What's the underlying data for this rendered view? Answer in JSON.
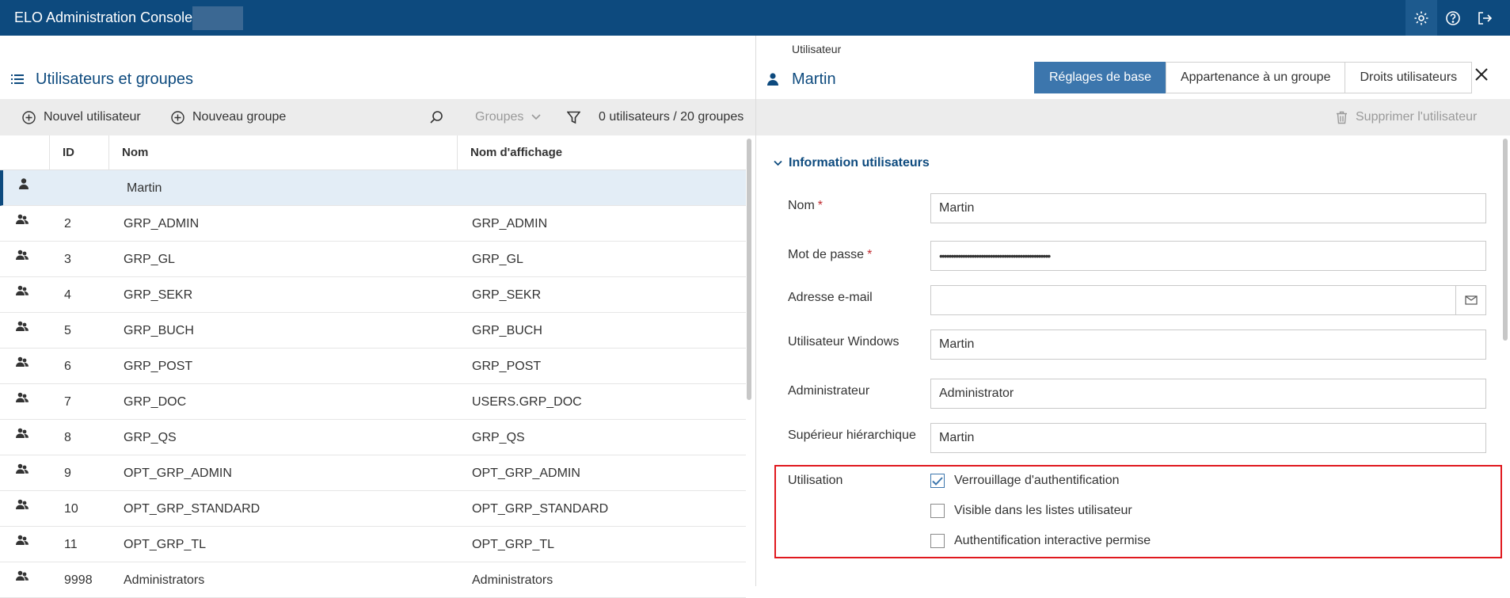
{
  "app": {
    "title": "ELO Administration Console"
  },
  "left": {
    "title": "Utilisateurs et groupes",
    "toolbar": {
      "new_user": "Nouvel utilisateur",
      "new_group": "Nouveau groupe",
      "filter_select": "Groupes",
      "count": "0 utilisateurs / 20 groupes"
    },
    "columns": {
      "id": "ID",
      "name": "Nom",
      "display": "Nom d'affichage"
    },
    "rows": [
      {
        "type": "user",
        "id": "",
        "name": "Martin",
        "display": ""
      },
      {
        "type": "group",
        "id": "2",
        "name": "GRP_ADMIN",
        "display": "GRP_ADMIN"
      },
      {
        "type": "group",
        "id": "3",
        "name": "GRP_GL",
        "display": "GRP_GL"
      },
      {
        "type": "group",
        "id": "4",
        "name": "GRP_SEKR",
        "display": "GRP_SEKR"
      },
      {
        "type": "group",
        "id": "5",
        "name": "GRP_BUCH",
        "display": "GRP_BUCH"
      },
      {
        "type": "group",
        "id": "6",
        "name": "GRP_POST",
        "display": "GRP_POST"
      },
      {
        "type": "group",
        "id": "7",
        "name": "GRP_DOC",
        "display": "USERS.GRP_DOC"
      },
      {
        "type": "group",
        "id": "8",
        "name": "GRP_QS",
        "display": "GRP_QS"
      },
      {
        "type": "group",
        "id": "9",
        "name": "OPT_GRP_ADMIN",
        "display": "OPT_GRP_ADMIN"
      },
      {
        "type": "group",
        "id": "10",
        "name": "OPT_GRP_STANDARD",
        "display": "OPT_GRP_STANDARD"
      },
      {
        "type": "group",
        "id": "11",
        "name": "OPT_GRP_TL",
        "display": "OPT_GRP_TL"
      },
      {
        "type": "group",
        "id": "9998",
        "name": "Administrators",
        "display": "Administrators"
      }
    ]
  },
  "right": {
    "breadcrumb": "Utilisateur",
    "title": "Martin",
    "tabs": [
      "Réglages de base",
      "Appartenance à un groupe",
      "Droits utilisateurs"
    ],
    "delete_label": "Supprimer l'utilisateur",
    "section_title": "Information utilisateurs",
    "fields": {
      "name_label": "Nom",
      "name_value": "Martin",
      "password_label": "Mot de passe",
      "password_value": "••••••••••••••••••••••••••••••••••••••••••••••••",
      "email_label": "Adresse e-mail",
      "email_value": "",
      "windows_label": "Utilisateur Windows",
      "windows_value": "Martin",
      "admin_label": "Administrateur",
      "admin_value": "Administrator",
      "superior_label": "Supérieur hiérarchique",
      "superior_value": "Martin"
    },
    "usage": {
      "label": "Utilisation",
      "options": [
        {
          "label": "Verrouillage d'authentification",
          "checked": true
        },
        {
          "label": "Visible dans les listes utilisateur",
          "checked": false
        },
        {
          "label": "Authentification interactive permise",
          "checked": false
        }
      ]
    }
  },
  "colors": {
    "header_bg": "#0d4a7e",
    "accent": "#3c76ad",
    "highlight": "#e0191f"
  }
}
